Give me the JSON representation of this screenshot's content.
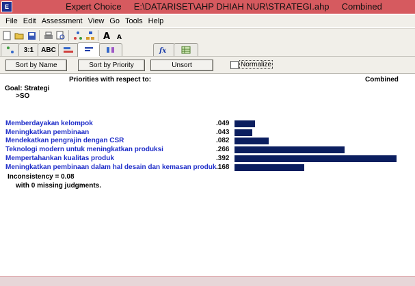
{
  "window": {
    "title": "Expert Choice     E:\\DATARISET\\AHP DHIAH NUR\\STRATEGI.ahp     Combined"
  },
  "menu": [
    "File",
    "Edit",
    "Assessment",
    "View",
    "Go",
    "Tools",
    "Help"
  ],
  "tabs": [
    "3:1",
    "ABC"
  ],
  "sort_buttons": {
    "by_name": "Sort by Name",
    "by_priority": "Sort by Priority",
    "unsort": "Unsort",
    "normalize": "Normalize",
    "normalize_checked": false
  },
  "report": {
    "header_left": "Priorities with respect to:",
    "header_right": "Combined",
    "goal": "Goal: Strategi",
    "goal_sub": ">SO",
    "inconsistency": "Inconsistency = 0.08",
    "missing": "with 0  missing judgments."
  },
  "chart_data": {
    "type": "bar",
    "categories": [
      "Memberdayakan kelompok",
      "Meningkatkan pembinaan",
      "Mendekatkan pengrajin dengan CSR",
      "Teknologi modern untuk meningkatkan produksi",
      "Mempertahankan kualitas produk",
      "Meningkatkan pembinaan dalam hal desain dan kemasan produk"
    ],
    "values": [
      0.049,
      0.043,
      0.082,
      0.266,
      0.392,
      0.168
    ],
    "value_labels": [
      ".049",
      ".043",
      ".082",
      ".266",
      ".392",
      ".168"
    ],
    "bar_color": "#0b1e5f",
    "label_color": "#1f2ec9"
  }
}
